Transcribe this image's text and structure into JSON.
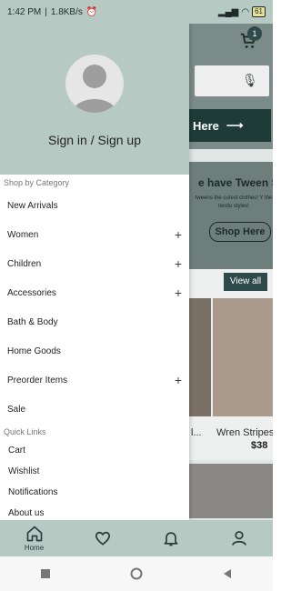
{
  "status_bar": {
    "time": "1:42 PM",
    "speed": "1.8KB/s",
    "battery": "61"
  },
  "drawer": {
    "signin_label": "Sign in / Sign up",
    "shop_by_category_label": "Shop by Category",
    "categories": [
      {
        "label": "New Arrivals",
        "expandable": false
      },
      {
        "label": "Women",
        "expandable": true
      },
      {
        "label": "Children",
        "expandable": true
      },
      {
        "label": "Accessories",
        "expandable": true
      },
      {
        "label": "Bath & Body",
        "expandable": false
      },
      {
        "label": "Home Goods",
        "expandable": false
      },
      {
        "label": "Preorder Items",
        "expandable": true
      },
      {
        "label": "Sale",
        "expandable": false
      }
    ],
    "quick_links_label": "Quick Links",
    "quick_links": [
      "Cart",
      "Wishlist",
      "Notifications",
      "About us"
    ]
  },
  "background": {
    "cart_count": "1",
    "here_button": "Here",
    "banner_title": "e have Tween S",
    "banner_subtitle": "tweens the cutest clothes! Y the tendu styles!",
    "shop_here": "Shop Here",
    "view_all": "View all",
    "product_name_1": "l...",
    "product_name_2": "Wren Stripes",
    "product_price_2": "$38"
  },
  "bottom_nav": {
    "home_label": "Home"
  },
  "colors": {
    "header_bg": "#b6c9c3",
    "accent_dark": "#2f4a4a"
  }
}
